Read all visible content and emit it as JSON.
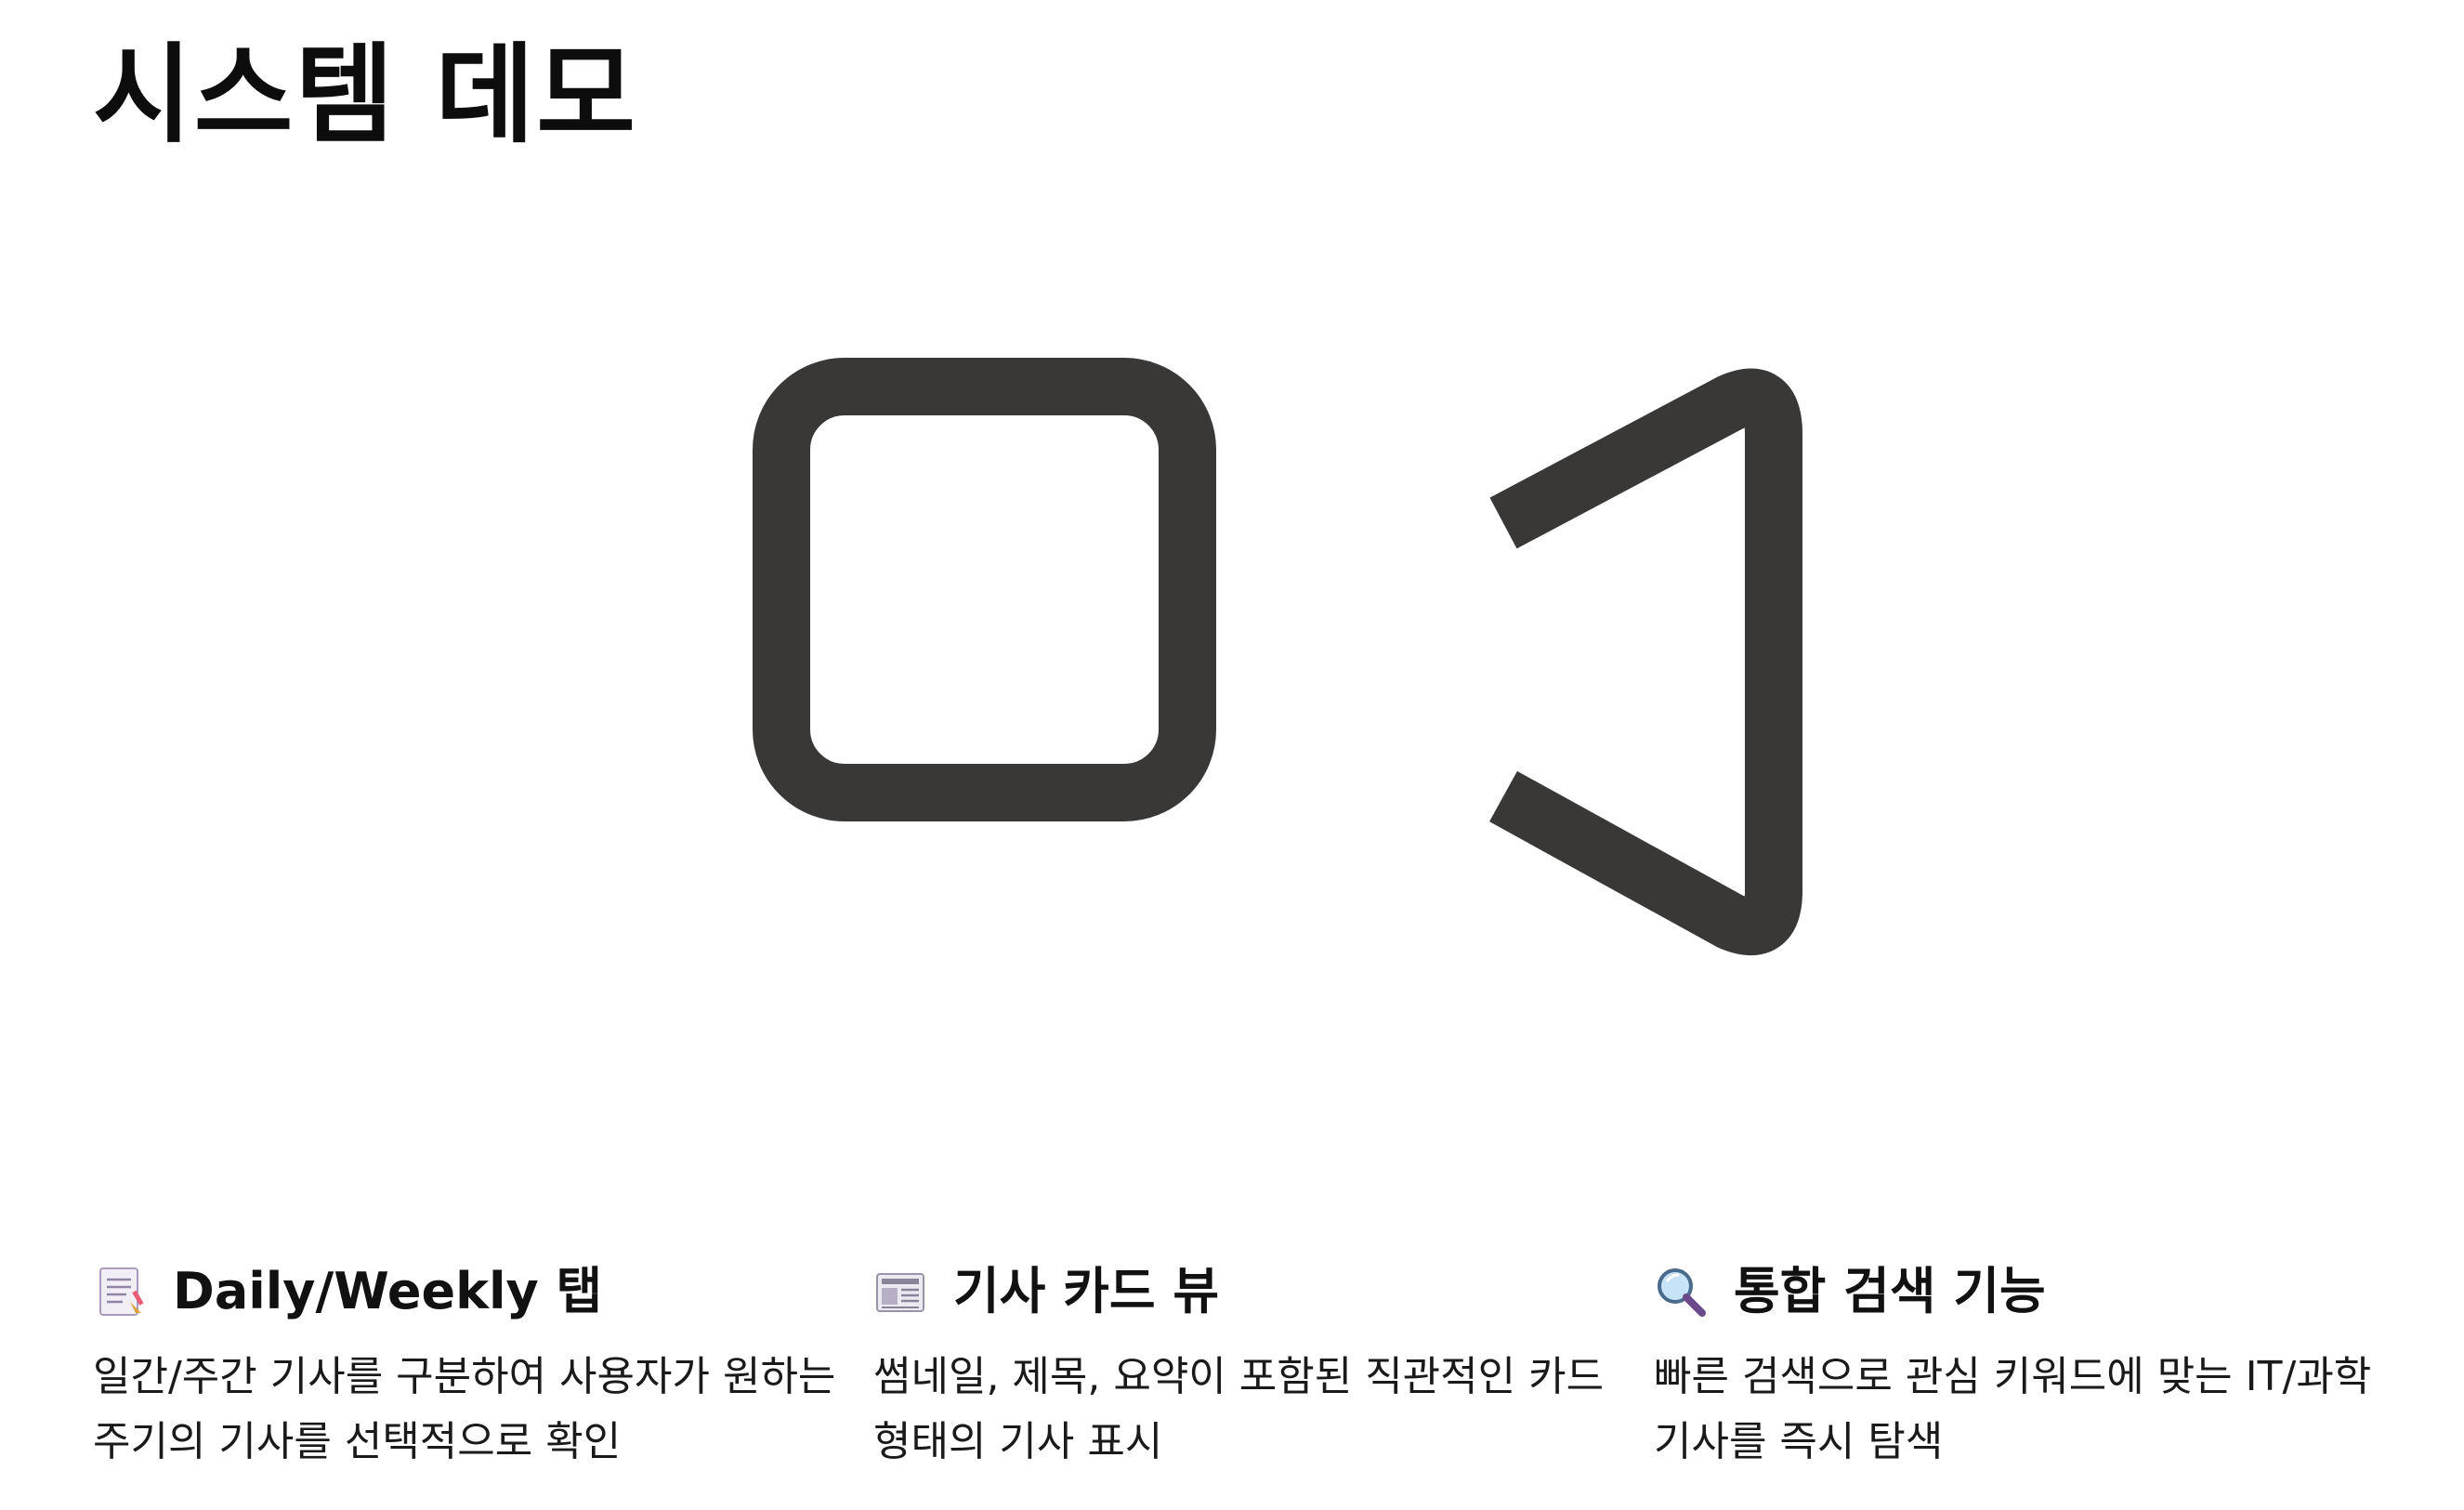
{
  "page": {
    "title": "시스템 데모"
  },
  "hero": {
    "icon": "video-camera-icon",
    "color": "#393837"
  },
  "features": [
    {
      "icon": "notepad-icon",
      "title": "Daily/Weekly 탭",
      "description": "일간/주간 기사를 구분하여 사용자가 원하는 주기의 기사를 선택적으로 확인"
    },
    {
      "icon": "newspaper-icon",
      "title": "기사 카드 뷰",
      "description": "썸네일, 제목, 요약이 포함된 직관적인 카드 형태의 기사 표시"
    },
    {
      "icon": "magnifying-glass-icon",
      "title": "통합 검색 기능",
      "description": "빠른 검색으로 관심 키워드에 맞는 IT/과학 기사를 즉시 탐색"
    }
  ]
}
